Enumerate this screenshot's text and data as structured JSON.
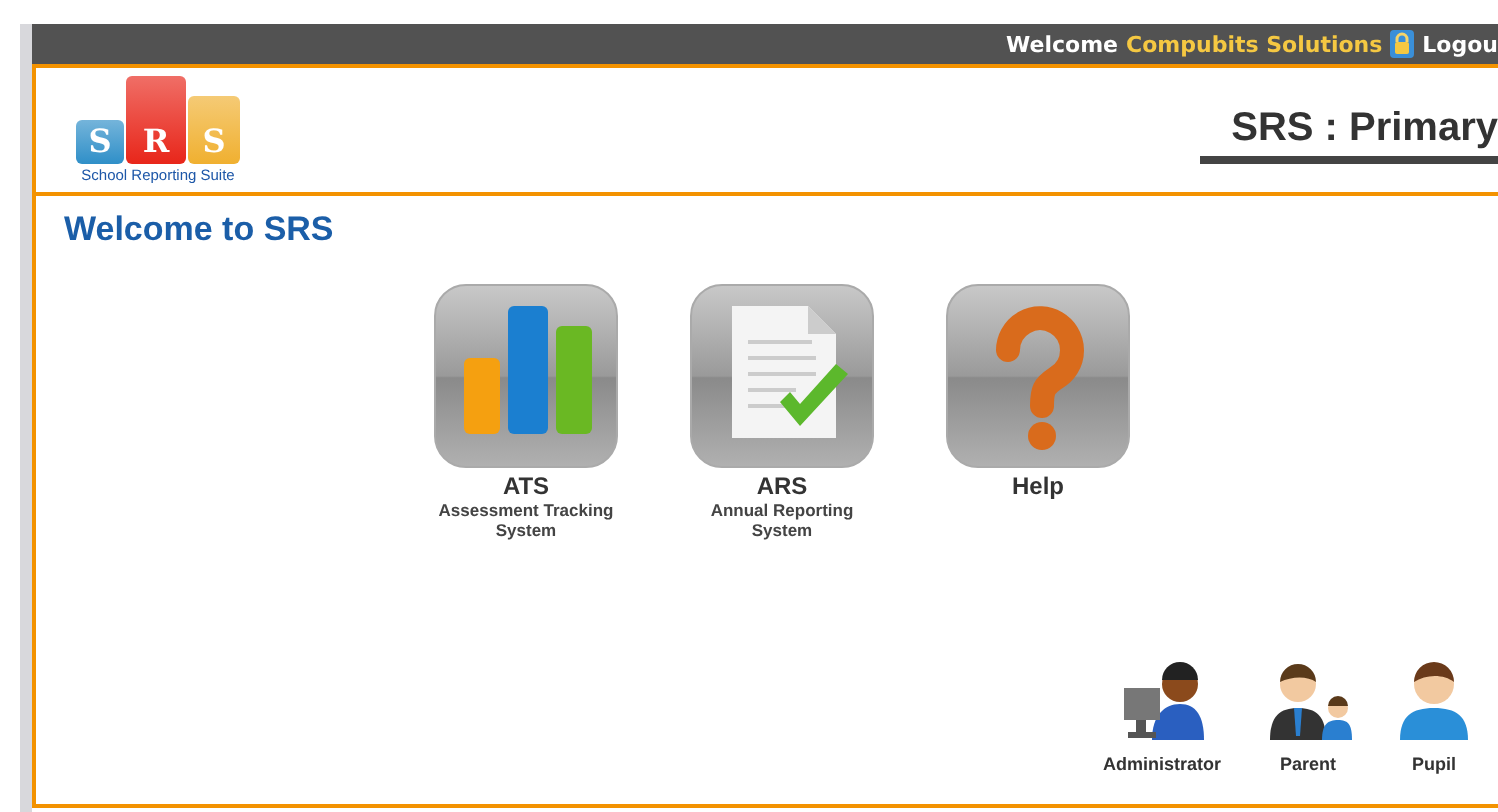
{
  "top_bar": {
    "welcome": "Welcome",
    "user": "Compubits Solutions",
    "logout": "Logou"
  },
  "logo": {
    "letters": [
      "S",
      "R",
      "S"
    ],
    "tagline": "School Reporting Suite"
  },
  "header": {
    "title": "SRS : Primary"
  },
  "page_title": "Welcome to SRS",
  "modules": [
    {
      "kind": "chart",
      "title": "ATS",
      "subtitle": "Assessment Tracking System"
    },
    {
      "kind": "report",
      "title": "ARS",
      "subtitle": "Annual Reporting System"
    },
    {
      "kind": "help",
      "title": "Help"
    }
  ],
  "roles": [
    {
      "kind": "admin",
      "label": "Administrator"
    },
    {
      "kind": "parent",
      "label": "Parent"
    },
    {
      "kind": "pupil",
      "label": "Pupil"
    }
  ]
}
